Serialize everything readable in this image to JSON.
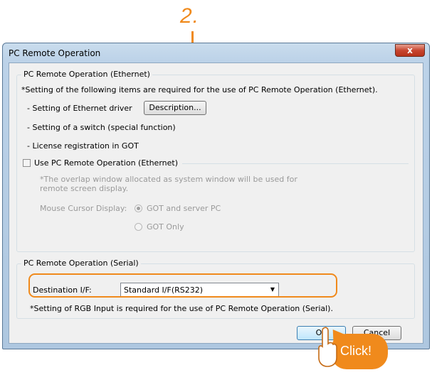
{
  "step_number": "2.",
  "dialog": {
    "title": "PC Remote Operation",
    "close_label": "x",
    "ethernet_group": {
      "legend": "PC Remote Operation (Ethernet)",
      "note": "*Setting of the following items are required for the use of PC Remote Operation (Ethernet).",
      "item1": "- Setting of Ethernet driver",
      "description_button": "Description...",
      "item2": "- Setting of a switch (special function)",
      "item3": "- License registration in GOT",
      "use_checkbox_label": "Use PC Remote Operation (Ethernet)",
      "use_checkbox_checked": false,
      "overlap_note_line1": "*The overlap window allocated as system window will be used for",
      "overlap_note_line2": "remote screen display.",
      "mouse_cursor_label": "Mouse Cursor Display:",
      "radio_got_and_server": "GOT and server PC",
      "radio_got_only": "GOT Only",
      "selected_radio": "GOT and server PC"
    },
    "serial_group": {
      "legend": "PC Remote Operation (Serial)",
      "destination_label": "Destination I/F:",
      "destination_value": "Standard I/F(RS232)",
      "note": "*Setting of RGB Input is required for the use of PC Remote Operation (Serial)."
    },
    "ok_label": "OK",
    "cancel_label": "Cancel"
  },
  "callout": {
    "click_label": "Click!"
  },
  "colors": {
    "accent": "#f08a1c"
  }
}
